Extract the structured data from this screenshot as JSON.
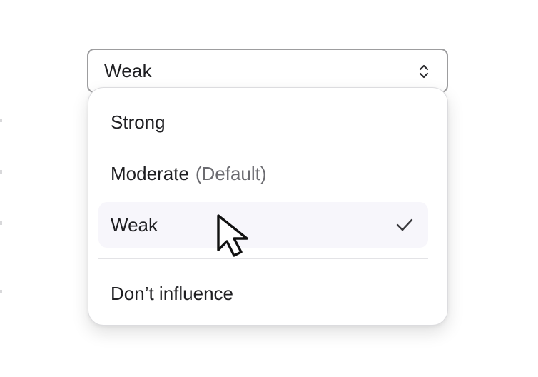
{
  "select": {
    "value": "Weak"
  },
  "options": [
    {
      "label": "Strong",
      "hint": "",
      "selected": false
    },
    {
      "label": "Moderate",
      "hint": "(Default)",
      "selected": false
    },
    {
      "label": "Weak",
      "hint": "",
      "selected": true
    },
    {
      "label": "Don’t influence",
      "hint": "",
      "selected": false
    }
  ],
  "icons": {
    "trigger": "chevron-up-down-icon",
    "selected": "checkmark-icon",
    "pointer": "mouse-cursor-arrow"
  },
  "colors": {
    "border": "#9d9d9f",
    "highlight": "#f7f6fb",
    "text": "#1f1f22",
    "muted": "#6b6b70"
  }
}
